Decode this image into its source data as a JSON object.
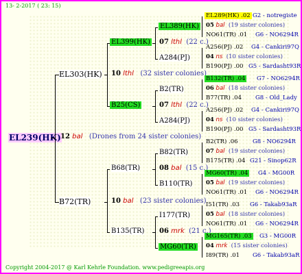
{
  "header": {
    "date": "13-  2-2017 ( 23: 15)"
  },
  "footer": {
    "copyright": "Copyright 2004-2017 @ Karl Kehrle Foundation.   www.pedigreeapis.org"
  },
  "root": {
    "id": "EL239(HK)",
    "num": "12",
    "cls": "bal",
    "note": "(Drones from 24 sister colonies)"
  },
  "gen1": {
    "top": {
      "id": "EL303(HK)",
      "num": "10",
      "cls": "lthl",
      "sis": "(32 sister colonies)"
    },
    "bottom": {
      "id": "B72(TR)",
      "num": "10",
      "cls": "bal",
      "sis": "(23 sister colonies)"
    }
  },
  "gen2": {
    "a": {
      "id": "EL399(HK)",
      "num": "07",
      "cls": "lthl",
      "sis": "(22 c.)"
    },
    "b": {
      "id": "B25(CS)",
      "num": "07",
      "cls": "lthl",
      "sis": "(22 c.)"
    },
    "c": {
      "id": "B68(TR)",
      "num": "08",
      "cls": "bal",
      "sis": "(15 c.)"
    },
    "d": {
      "id": "B135(TR)",
      "num": "06",
      "cls": "mrk",
      "sis": "(21 c.)"
    }
  },
  "gen3": {
    "a1": "EL389(HK)",
    "a2": "A284(PJ)",
    "b1": "B2(TR)",
    "b2": "A284(PJ)",
    "c1": "B82(TR)",
    "c2": "B110(TR)",
    "d1": "I177(TR)",
    "d2": "MG60(TR)"
  },
  "gen4": [
    {
      "top": "EL289(HK) .02",
      "topsrc": "G2 - notregiste",
      "num": "05",
      "cls": "bal",
      "sis": "(19 sister colonies)",
      "bot": "NO61(TR) .01",
      "botsrc": "G6 - NO6294R"
    },
    {
      "top": "A256(PJ) .02",
      "topsrc": "G4 - Cankiri97Q",
      "num": "04",
      "cls": "ns",
      "sis": "(10 sister colonies)",
      "bot": "B190(PJ) .00",
      "botsrc": "G5 - Sardasht93R"
    },
    {
      "top": "B132(TR) .04",
      "topsrc": "G7 - NO6294R",
      "num": "06",
      "cls": "bal",
      "sis": "(18 sister colonies)",
      "bot": "B77(TR) .04",
      "botsrc": "G8 - Old_Lady"
    },
    {
      "top": "A256(PJ) .02",
      "topsrc": "G4 - Cankiri97Q",
      "num": "04",
      "cls": "ns",
      "sis": "(10 sister colonies)",
      "bot": "B190(PJ) .00",
      "botsrc": "G5 - Sardasht93R"
    },
    {
      "top": "B2(TR) .06",
      "topsrc": "G8 - NO6294R",
      "num": "07",
      "cls": "bal",
      "sis": "(19 sister colonies)",
      "bot": "B175(TR) .04",
      "botsrc": "G21 - Sinop62R"
    },
    {
      "top": "MG60(TR) .04",
      "topsrc": "G4 - MG00R",
      "num": "05",
      "cls": "bal",
      "sis": "(19 sister colonies)",
      "bot": "NO61(TR) .01",
      "botsrc": "G6 - NO6294R"
    },
    {
      "top": "I51(TR) .03",
      "topsrc": "G6 - Takab93aR",
      "num": "05",
      "cls": "bal",
      "sis": "(18 sister colonies)",
      "bot": "NO61(TR) .01",
      "botsrc": "G6 - NO6294R"
    },
    {
      "top": "MG165(TR) .03",
      "topsrc": "G3 - MG00R",
      "num": "04",
      "cls": "mrk",
      "sis": "(15 sister colonies)",
      "bot": "I89(TR) .01",
      "botsrc": "G6 - Takab93aR"
    }
  ]
}
